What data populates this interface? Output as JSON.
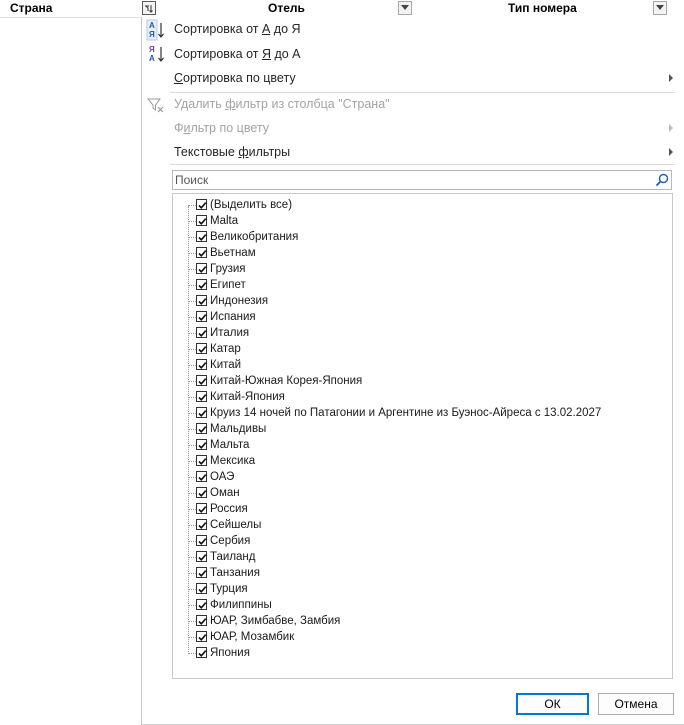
{
  "header": {
    "col_country": "Страна",
    "col_hotel": "Отель",
    "col_room_type": "Тип номера"
  },
  "menu": {
    "sort_asc_prefix": "Сортировка от ",
    "sort_asc_a": "А",
    "sort_asc_mid": " до Я",
    "sort_desc_prefix": "Сортировка от ",
    "sort_desc_ya": "Я",
    "sort_desc_mid": " до А",
    "sort_by_color_u": "С",
    "sort_by_color_rest": "ортировка по цвету",
    "clear_filter_pre": "Удалить ",
    "clear_filter_u": "ф",
    "clear_filter_rest": "ильтр из столбца \"Страна\"",
    "filter_by_color_pre": "Ф",
    "filter_by_color_u": "и",
    "filter_by_color_rest": "льтр по цвету",
    "text_filters_pre": "Текстовые ",
    "text_filters_u": "ф",
    "text_filters_rest": "ильтры",
    "icon_sort_asc": "sort-a-to-z-icon",
    "icon_sort_desc": "sort-z-to-a-icon",
    "icon_clear_filter": "clear-filter-icon"
  },
  "search": {
    "placeholder": "Поиск",
    "value": "",
    "icon": "search-icon"
  },
  "list": {
    "items": [
      "(Выделить все)",
      "Malta",
      "Великобритания",
      "Вьетнам",
      "Грузия",
      "Египет",
      "Индонезия",
      "Испания",
      "Италия",
      "Катар",
      "Китай",
      "Китай-Южная Корея-Япония",
      "Китай-Япония",
      "Круиз 14 ночей по Патагонии и Аргентине из Буэнос-Айреса с 13.02.2027",
      "Мальдивы",
      "Мальта",
      "Мексика",
      "ОАЭ",
      "Оман",
      "Россия",
      "Сейшелы",
      "Сербия",
      "Таиланд",
      "Танзания",
      "Турция",
      "Филиппины",
      "ЮАР, Зимбабве, Замбия",
      "ЮАР, Мозамбик",
      "Япония"
    ],
    "all_checked": true
  },
  "buttons": {
    "ok": "ОК",
    "cancel": "Отмена"
  },
  "colors": {
    "accent": "#0078d4",
    "disabled_text": "#a3a3a3"
  }
}
